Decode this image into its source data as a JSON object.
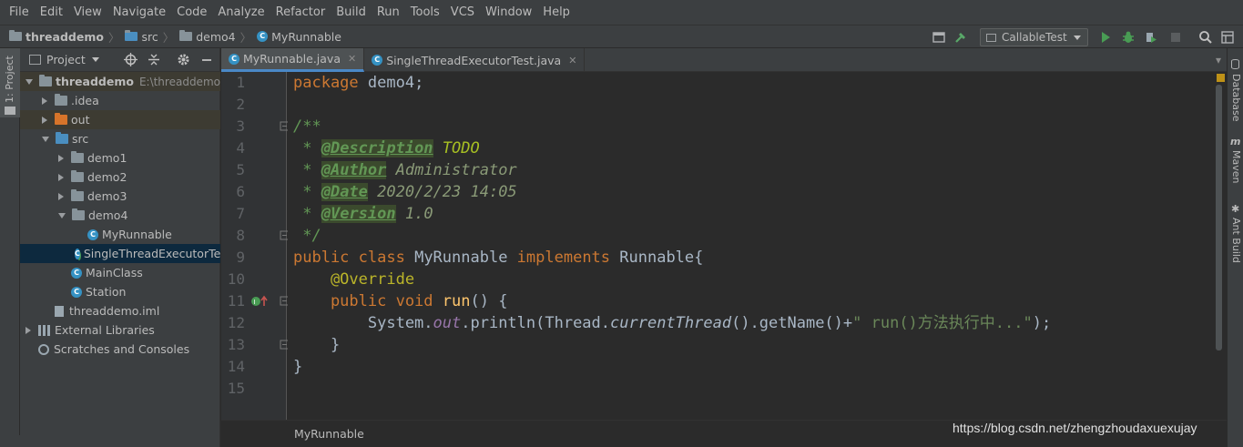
{
  "menu": [
    "File",
    "Edit",
    "View",
    "Navigate",
    "Code",
    "Analyze",
    "Refactor",
    "Build",
    "Run",
    "Tools",
    "VCS",
    "Window",
    "Help"
  ],
  "nav": {
    "crumbs": [
      "threaddemo",
      "src",
      "demo4",
      "MyRunnable"
    ],
    "run_config": "CallableTest"
  },
  "left_stripe": {
    "project_tool": "1: Project"
  },
  "project_panel": {
    "title": "Project",
    "tree": [
      {
        "label": "threaddemo",
        "extra": "E:\\threaddemo",
        "kind": "module",
        "depth": 0,
        "expanded": true
      },
      {
        "label": ".idea",
        "kind": "folder",
        "depth": 1,
        "expanded": false
      },
      {
        "label": "out",
        "kind": "folder-orange",
        "depth": 1,
        "expanded": false
      },
      {
        "label": "src",
        "kind": "folder-blue",
        "depth": 1,
        "expanded": true
      },
      {
        "label": "demo1",
        "kind": "package",
        "depth": 2,
        "expanded": false
      },
      {
        "label": "demo2",
        "kind": "package",
        "depth": 2,
        "expanded": false
      },
      {
        "label": "demo3",
        "kind": "package",
        "depth": 2,
        "expanded": false
      },
      {
        "label": "demo4",
        "kind": "package",
        "depth": 2,
        "expanded": true
      },
      {
        "label": "MyRunnable",
        "kind": "class",
        "depth": 3
      },
      {
        "label": "SingleThreadExecutorTest",
        "kind": "class-run",
        "depth": 3,
        "selected": true
      },
      {
        "label": "MainClass",
        "kind": "class",
        "depth": 2
      },
      {
        "label": "Station",
        "kind": "class",
        "depth": 2
      },
      {
        "label": "threaddemo.iml",
        "kind": "iml",
        "depth": 1
      },
      {
        "label": "External Libraries",
        "kind": "libs",
        "depth": 0,
        "expanded": false
      },
      {
        "label": "Scratches and Consoles",
        "kind": "scratch",
        "depth": 0
      }
    ]
  },
  "tabs": [
    {
      "label": "MyRunnable.java",
      "active": true
    },
    {
      "label": "SingleThreadExecutorTest.java",
      "active": false
    }
  ],
  "editor": {
    "line_numbers": [
      "1",
      "2",
      "3",
      "4",
      "5",
      "6",
      "7",
      "8",
      "9",
      "10",
      "11",
      "12",
      "13",
      "14",
      "15"
    ],
    "code": {
      "l1_kw": "package",
      "l1_rest": " demo4;",
      "l3": "/**",
      "l4_star": " * ",
      "l4_tag": "@Description",
      "l4_val": " TODO",
      "l5_star": " * ",
      "l5_tag": "@Author",
      "l5_val": " Administrator",
      "l6_star": " * ",
      "l6_tag": "@Date",
      "l6_val": " 2020/2/23 14:05",
      "l7_star": " * ",
      "l7_tag": "@Version",
      "l7_val": " 1.0",
      "l8": " */",
      "l9_kw1": "public",
      "l9_kw2": " class",
      "l9_name": " MyRunnable",
      "l9_kw3": " implements",
      "l9_rest": " Runnable{",
      "l10": "    @Override",
      "l11_kw": "    public void",
      "l11_fn": " run",
      "l11_rest": "() {",
      "l12_a": "        System.",
      "l12_out": "out",
      "l12_b": ".println(Thread.",
      "l12_ct": "currentThread",
      "l12_c": "().getName()+",
      "l12_str": "\" run()方法执行中...\"",
      "l12_d": ");",
      "l13": "    }",
      "l14": "}"
    }
  },
  "right_stripe": [
    "Database",
    "Maven",
    "Ant Build"
  ],
  "status": {
    "breadcrumb": "MyRunnable"
  },
  "watermark": "https://blog.csdn.net/zhengzhoudaxuexujay",
  "colors": {
    "bg": "#2b2b2b",
    "panel": "#3c3f41",
    "keyword": "#cc7832",
    "doc": "#629755",
    "annotation": "#bbb529",
    "string": "#6a8759",
    "selection": "#0d293e"
  }
}
